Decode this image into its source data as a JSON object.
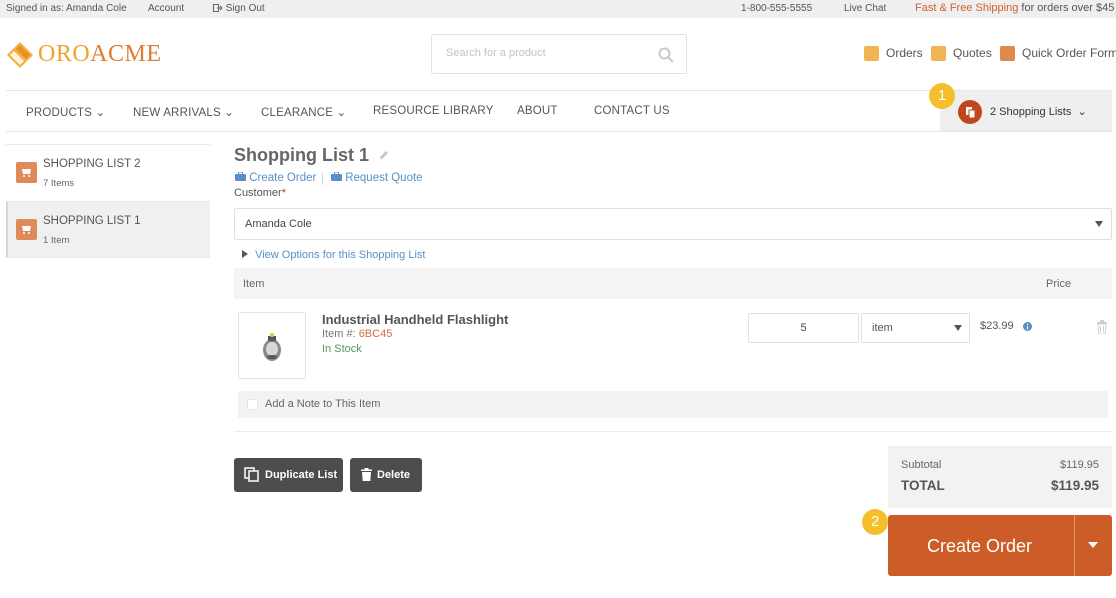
{
  "topbar": {
    "signed_in": "Signed in as: Amanda Cole",
    "account": "Account",
    "sign_out": "Sign Out",
    "phone": "1-800-555-5555",
    "live_chat": "Live Chat",
    "shipping_highlight": "Fast & Free Shipping",
    "shipping_rest": "for orders over $45"
  },
  "header": {
    "logo_part1": "ORO",
    "logo_part2": "ACME",
    "search_placeholder": "Search for a product",
    "links": {
      "orders": "Orders",
      "quotes": "Quotes",
      "quick_order": "Quick Order Form"
    }
  },
  "nav": {
    "items": [
      "PRODUCTS",
      "NEW ARRIVALS",
      "CLEARANCE",
      "RESOURCE LIBRARY",
      "ABOUT",
      "CONTACT US"
    ],
    "shopping_lists": "2 Shopping Lists"
  },
  "badges": {
    "one": "1",
    "two": "2"
  },
  "sidebar": {
    "items": [
      {
        "title": "SHOPPING LIST 2",
        "count": "7 Items"
      },
      {
        "title": "SHOPPING LIST 1",
        "count": "1 Item"
      }
    ]
  },
  "main": {
    "title": "Shopping List 1",
    "create_order_link": "Create Order",
    "request_quote_link": "Request Quote",
    "customer_label": "Customer",
    "required_mark": "*",
    "customer_value": "Amanda Cole",
    "view_options": "View Options for this Shopping List",
    "table": {
      "col_item": "Item",
      "col_price": "Price"
    },
    "line_item": {
      "name": "Industrial Handheld Flashlight",
      "sku_label": "Item #:",
      "sku": "6BC45",
      "stock": "In Stock",
      "quantity": "5",
      "unit": "item",
      "price": "$23.99"
    },
    "note_label": "Add a Note to This Item",
    "duplicate_button": "Duplicate List",
    "delete_button": "Delete"
  },
  "totals": {
    "subtotal_label": "Subtotal",
    "subtotal_value": "$119.95",
    "total_label": "TOTAL",
    "total_value": "$119.95"
  },
  "actions": {
    "create_order": "Create Order"
  },
  "colors": {
    "accent": "#cc5d28",
    "badge": "#f4bf2a",
    "link": "#5a8fc3",
    "logo": "#f0a32a"
  }
}
